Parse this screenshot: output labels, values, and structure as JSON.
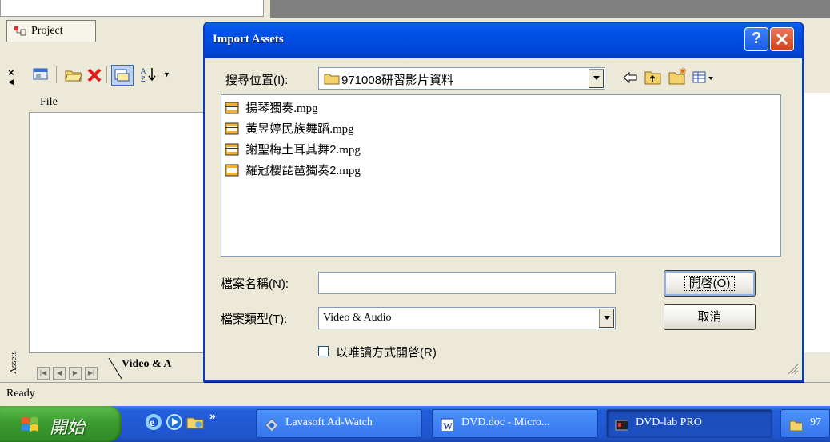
{
  "background_app": {
    "project_tab_label": "Project",
    "file_column_header": "File",
    "bottom_tab_label": "Video & A",
    "side_label": "Assets",
    "status_text": "Ready"
  },
  "dialog": {
    "title": "Import Assets",
    "look_in_label": "搜尋位置(I):",
    "look_in_value": "971008研習影片資料",
    "files": [
      {
        "name": "揚琴獨奏",
        "ext": ".mpg"
      },
      {
        "name": "黃昱婷民族舞蹈",
        "ext": ".mpg"
      },
      {
        "name": "謝聖梅土耳其舞2",
        "ext": ".mpg"
      },
      {
        "name": "羅冠樱琵琶獨奏2",
        "ext": ".mpg"
      }
    ],
    "filename_label": "檔案名稱(N):",
    "filename_value": "",
    "filetype_label": "檔案類型(T):",
    "filetype_value": "Video & Audio",
    "open_button": "開啓(O)",
    "cancel_button": "取消",
    "readonly_checkbox_label": "以唯讀方式開啓(R)",
    "readonly_checked": false
  },
  "taskbar": {
    "start_label": "開始",
    "overflow_glyph": "»",
    "items": [
      {
        "label": "Lavasoft Ad-Watch"
      },
      {
        "label": "DVD.doc - Micro..."
      },
      {
        "label": "DVD-lab PRO"
      },
      {
        "label": "97"
      }
    ]
  },
  "icons": {
    "toolbar": [
      "close-x-icon",
      "panel-icon",
      "open-folder-icon",
      "delete-x-icon",
      "import-icon",
      "sort-icon"
    ],
    "dialog_nav": [
      "back-arrow-icon",
      "up-folder-icon",
      "new-folder-icon",
      "view-menu-icon"
    ],
    "file_type": "video-file-icon"
  },
  "colors": {
    "titlebar": "#0050e6",
    "taskbar": "#245edb",
    "start": "#3c9b30",
    "close_button": "#d2411a"
  }
}
